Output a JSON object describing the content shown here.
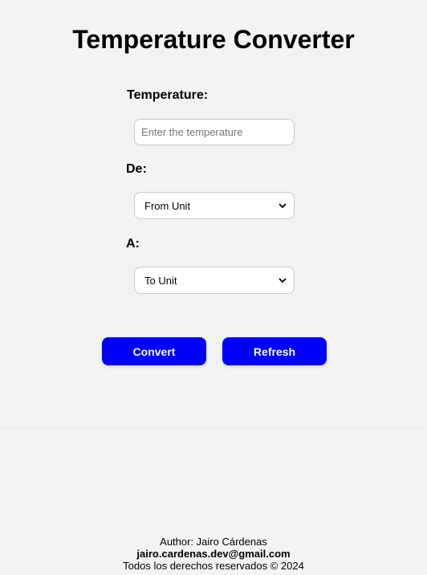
{
  "header": {
    "title": "Temperature Converter"
  },
  "form": {
    "temperature_label": "Temperature:",
    "temperature_placeholder": "Enter the temperature",
    "temperature_value": "",
    "from_label": "De:",
    "from_selected": "From Unit",
    "to_label": "A:",
    "to_selected": "To Unit"
  },
  "buttons": {
    "convert_label": "Convert",
    "refresh_label": "Refresh"
  },
  "footer": {
    "author": "Author: Jairo Cárdenas",
    "email": "jairo.cardenas.dev@gmail.com",
    "rights": "Todos los derechos reservados © 2024"
  },
  "colors": {
    "background": "#f3f3f3",
    "button": "#0000ff",
    "button_text": "#ffffff"
  },
  "icons": {
    "select_arrow": "chevron-down-icon"
  }
}
